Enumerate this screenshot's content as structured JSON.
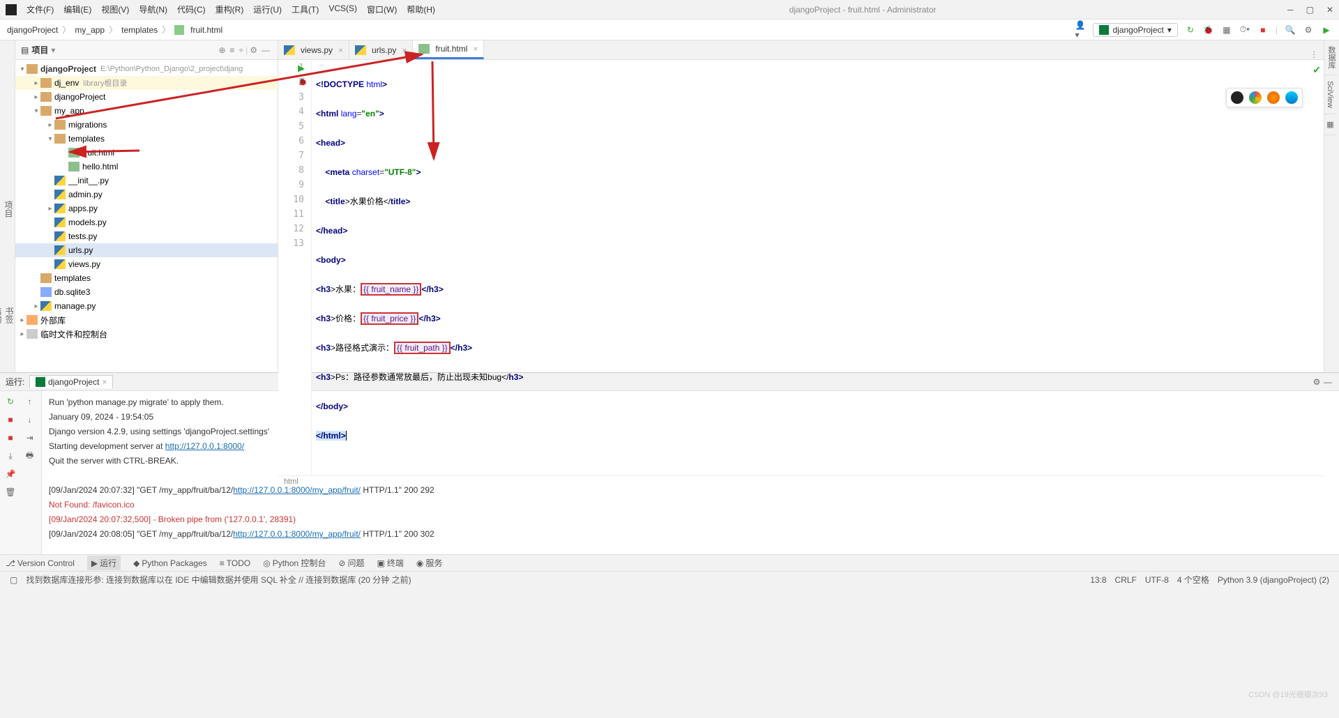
{
  "window": {
    "title": "djangoProject - fruit.html - Administrator"
  },
  "menu": {
    "file": "文件(F)",
    "edit": "编辑(E)",
    "view": "视图(V)",
    "nav": "导航(N)",
    "code": "代码(C)",
    "refactor": "重构(R)",
    "run": "运行(U)",
    "tools": "工具(T)",
    "vcs": "VCS(S)",
    "window": "窗口(W)",
    "help": "帮助(H)"
  },
  "breadcrumb": {
    "p0": "djangoProject",
    "p1": "my_app",
    "p2": "templates",
    "p3": "fruit.html"
  },
  "run_config": "djangoProject",
  "project_title": "项目",
  "side_left": {
    "project": "项目",
    "bookmarks": "书签",
    "structure": "结构"
  },
  "tree": {
    "root": "djangoProject",
    "root_hint": "E:\\Python\\Python_Django\\2_project\\djang",
    "dj_env": "dj_env",
    "dj_env_hint": "library根目录",
    "djangoProject2": "djangoProject",
    "my_app": "my_app",
    "migrations": "migrations",
    "templates": "templates",
    "fruit_html": "fruit.html",
    "hello_html": "hello.html",
    "init_py": "__init__.py",
    "admin_py": "admin.py",
    "apps_py": "apps.py",
    "models_py": "models.py",
    "tests_py": "tests.py",
    "urls_py": "urls.py",
    "views_py": "views.py",
    "templates2": "templates",
    "db": "db.sqlite3",
    "manage_py": "manage.py",
    "ext_lib": "外部库",
    "scratch": "临时文件和控制台"
  },
  "tabs": {
    "t0": "views.py",
    "t1": "urls.py",
    "t2": "fruit.html"
  },
  "code_lines": [
    "1",
    "2",
    "3",
    "4",
    "5",
    "6",
    "7",
    "8",
    "9",
    "10",
    "11",
    "12",
    "13"
  ],
  "code": {
    "l1_a": "<!DOCTYPE ",
    "l1_b": "html",
    "l1_c": ">",
    "l2_a": "<",
    "l2_b": "html ",
    "l2_c": "lang",
    "l2_d": "=",
    "l2_e": "\"en\"",
    "l2_f": ">",
    "l3_a": "<",
    "l3_b": "head",
    "l3_c": ">",
    "l4_a": "    <",
    "l4_b": "meta ",
    "l4_c": "charset",
    "l4_d": "=",
    "l4_e": "\"UTF-8\"",
    "l4_f": ">",
    "l5_a": "    <",
    "l5_b": "title",
    "l5_c": ">水果价格</",
    "l5_d": "title",
    "l5_e": ">",
    "l6_a": "</",
    "l6_b": "head",
    "l6_c": ">",
    "l7_a": "<",
    "l7_b": "body",
    "l7_c": ">",
    "l8_a": "<",
    "l8_b": "h3",
    "l8_c": ">水果：",
    "l8_box": "{{ fruit_name }}",
    "l8_d": "</",
    "l8_e": "h3",
    "l8_f": ">",
    "l9_a": "<",
    "l9_b": "h3",
    "l9_c": ">价格：",
    "l9_box": "{{ fruit_price }}",
    "l9_d": "</",
    "l9_e": "h3",
    "l9_f": ">",
    "l10_a": "<",
    "l10_b": "h3",
    "l10_c": ">路径格式演示：",
    "l10_box": "{{ fruit_path }}",
    "l10_d": "</",
    "l10_e": "h3",
    "l10_f": ">",
    "l11_a": "<",
    "l11_b": "h3",
    "l11_c": ">Ps：路径参数通常放最后，防止出现未知bug</",
    "l11_d": "h3",
    "l11_e": ">",
    "l12_a": "</",
    "l12_b": "body",
    "l12_c": ">",
    "l13_a": "</",
    "l13_b": "html",
    "l13_c": ">"
  },
  "crumb_bottom": "html",
  "side_right": {
    "db": "数据库",
    "sci": "SciView"
  },
  "run": {
    "label": "运行:",
    "tab": "djangoProject",
    "l1": "Run 'python manage.py migrate' to apply them.",
    "l2": "January 09, 2024 - 19:54:05",
    "l3": "Django version 4.2.9, using settings 'djangoProject.settings'",
    "l4a": "Starting development server at ",
    "l4b": "http://127.0.0.1:8000/",
    "l5": "Quit the server with CTRL-BREAK.",
    "l6a": "[09/Jan/2024 20:07:32] \"GET /my_app/fruit/ba/12/",
    "l6b": "http://127.0.0.1:8000/my_app/fruit/",
    "l6c": " HTTP/1.1\" 200 292",
    "l7": "Not Found: /favicon.ico",
    "l8": "[09/Jan/2024 20:07:32,500] - Broken pipe from ('127.0.0.1', 28391)",
    "l9a": "[09/Jan/2024 20:08:05] \"GET /my_app/fruit/ba/12/",
    "l9b": "http://127.0.0.1:8000/my_app/fruit/",
    "l9c": " HTTP/1.1\" 200 302"
  },
  "bottom": {
    "vc": "Version Control",
    "run": "运行",
    "pp": "Python Packages",
    "todo": "TODO",
    "pyc": "Python 控制台",
    "prob": "问题",
    "term": "终端",
    "svc": "服务"
  },
  "status": {
    "msg": "找到数据库连接形参: 连接到数据库以在 IDE 中编辑数据并使用 SQL 补全 // 连接到数据库 (20 分钟 之前)",
    "pos": "13:8",
    "eol": "CRLF",
    "enc": "UTF-8",
    "indent": "4 个空格",
    "py": "Python 3.9 (djangoProject) (2)"
  },
  "watermark": "CSDN @19光栅瓣次93"
}
